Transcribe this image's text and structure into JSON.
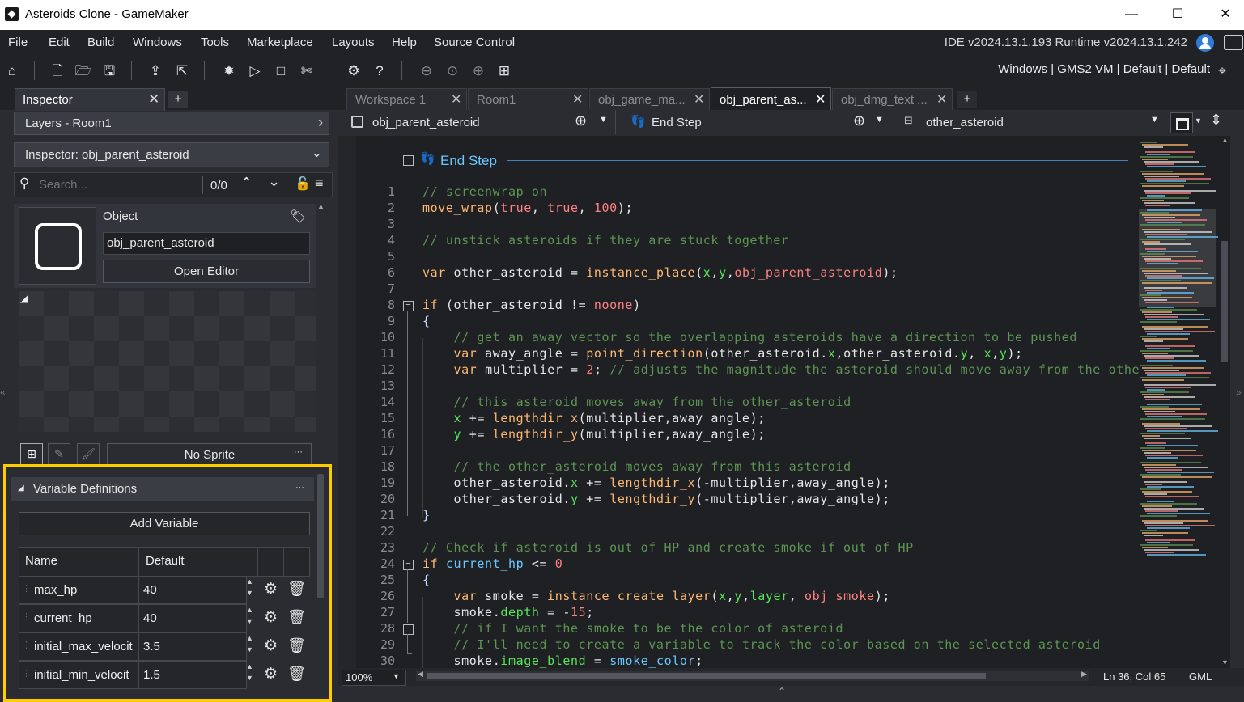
{
  "window": {
    "title": "Asteroids Clone - GameMaker",
    "minimize": "—",
    "maximize": "☐",
    "close": "✕"
  },
  "menu": {
    "items": [
      "File",
      "Edit",
      "Build",
      "Windows",
      "Tools",
      "Marketplace",
      "Layouts",
      "Help",
      "Source Control"
    ],
    "ide_version": "IDE v2024.13.1.193  Runtime v2024.13.1.242"
  },
  "toolbar": {
    "targets": "Windows | GMS2 VM | Default | Default"
  },
  "left": {
    "tab_label": "Inspector",
    "tab_add": "+",
    "layers": "Layers - Room1",
    "inspector_title": "Inspector: obj_parent_asteroid",
    "search_placeholder": "Search...",
    "search_count": "0/0",
    "object_heading": "Object",
    "object_name": "obj_parent_asteroid",
    "open_editor": "Open Editor",
    "sprite_label": "No Sprite",
    "sprite_more": "···",
    "vardefs_title": "Variable Definitions",
    "vardefs_more": "···",
    "add_variable": "Add Variable",
    "col_name": "Name",
    "col_default": "Default",
    "variables": [
      {
        "name": "max_hp",
        "value": "40"
      },
      {
        "name": "current_hp",
        "value": "40"
      },
      {
        "name": "initial_max_velocit",
        "value": "3.5"
      },
      {
        "name": "initial_min_velocit",
        "value": "1.5"
      }
    ]
  },
  "editor": {
    "tabs": [
      "Workspace 1",
      "Room1",
      "obj_game_ma...",
      "obj_parent_as...",
      "obj_dmg_text ..."
    ],
    "tab_add": "+",
    "object_dropdown": "obj_parent_asteroid",
    "event_dropdown": "End Step",
    "symbol_dropdown": "other_asteroid",
    "event_header": "End Step",
    "zoom": "100%",
    "cursor": "Ln 36, Col 65",
    "language": "GML",
    "line_numbers": [
      "1",
      "2",
      "3",
      "4",
      "5",
      "6",
      "7",
      "8",
      "9",
      "10",
      "11",
      "12",
      "13",
      "14",
      "15",
      "16",
      "17",
      "18",
      "19",
      "20",
      "21",
      "22",
      "23",
      "24",
      "25",
      "26",
      "27",
      "28",
      "29",
      "30"
    ]
  },
  "colors": {
    "comment": "#5d9553",
    "keyword": "#ffb871",
    "number": "#ff8080",
    "highlight": "#ffcc00"
  }
}
